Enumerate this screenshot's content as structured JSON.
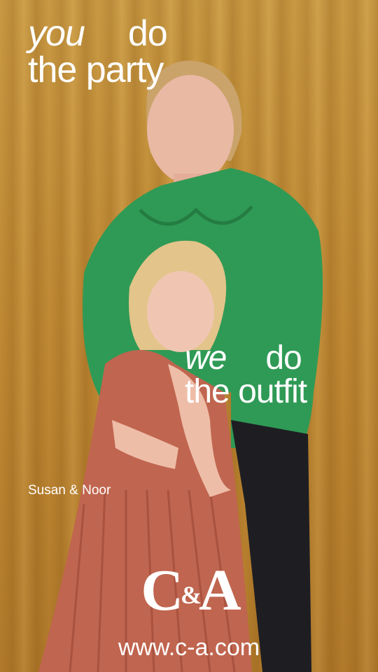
{
  "headline_top": {
    "line1_em": "you",
    "line1_rest": "do",
    "line2": "the party"
  },
  "headline_bottom": {
    "line1_em": "we",
    "line1_rest": "do",
    "line2": "the outfit"
  },
  "caption": "Susan & Noor",
  "logo": {
    "c": "C",
    "amp": "&",
    "a": "A"
  },
  "url": "www.c-a.com",
  "colors": {
    "backdrop": "#c39240",
    "blouse": "#2f9a55",
    "dress": "#c0654f",
    "text": "#ffffff"
  }
}
